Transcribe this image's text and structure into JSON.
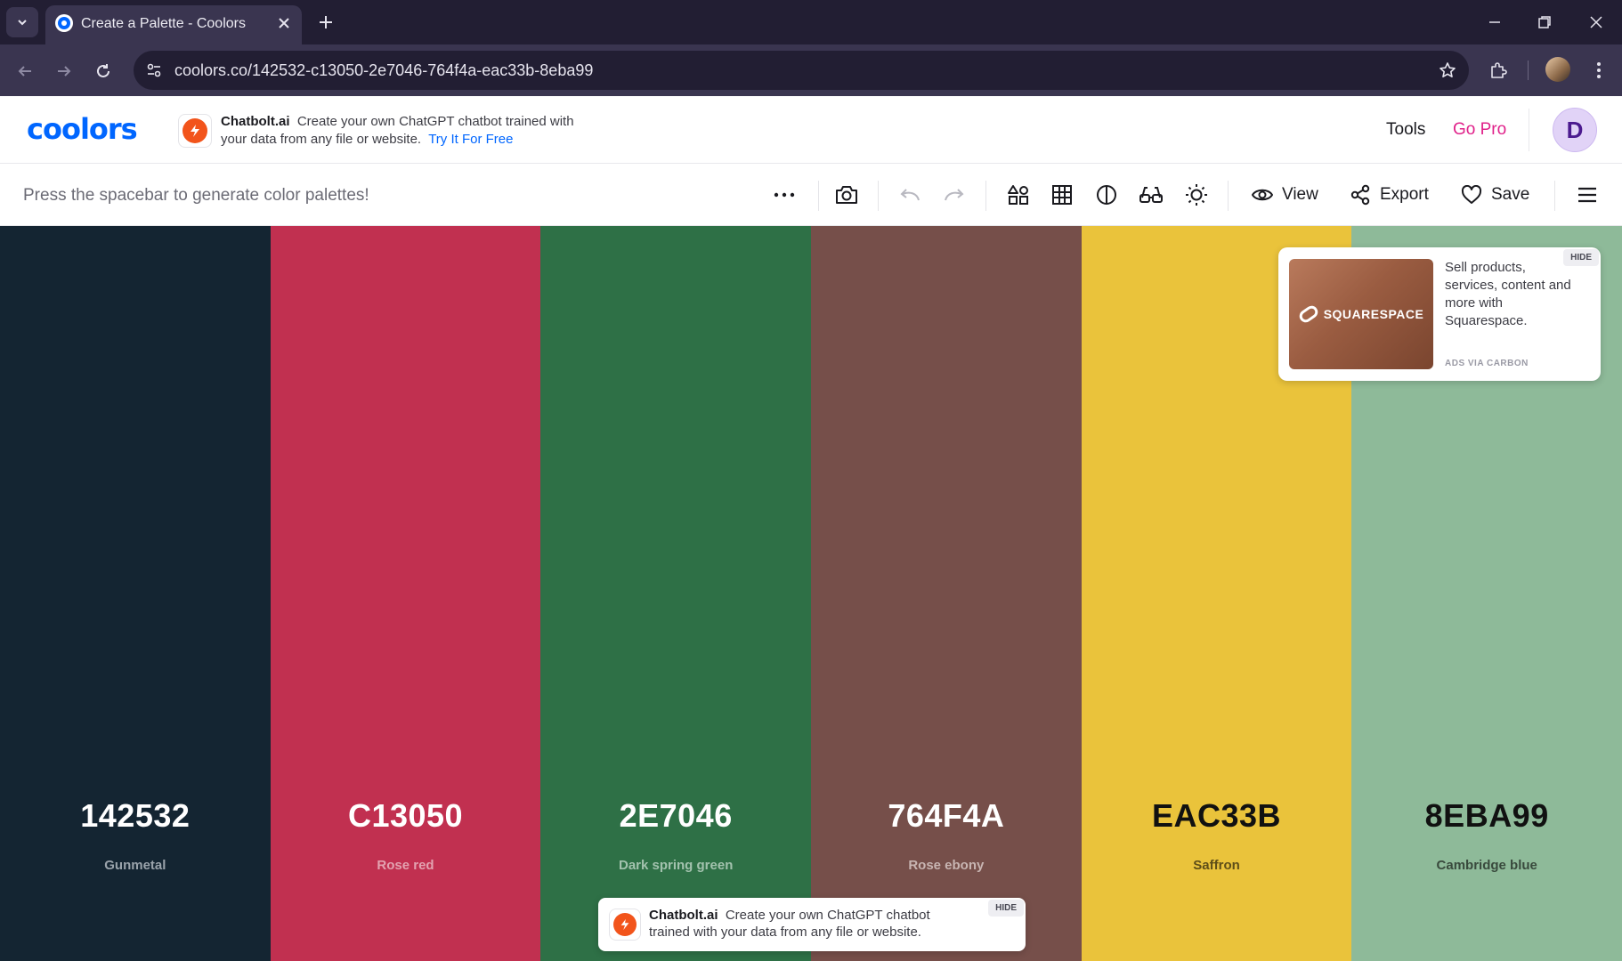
{
  "browser": {
    "tab_title": "Create a Palette - Coolors",
    "url": "coolors.co/142532-c13050-2e7046-764f4a-eac33b-8eba99"
  },
  "header": {
    "logo": "coolors",
    "ad": {
      "brand": "Chatbolt.ai",
      "text": "Create your own ChatGPT chatbot trained with your data from any file or website.",
      "cta": "Try It For Free"
    },
    "tools": "Tools",
    "go_pro": "Go Pro",
    "avatar_initial": "D"
  },
  "toolbar": {
    "hint": "Press the spacebar to generate color palettes!",
    "view": "View",
    "export": "Export",
    "save": "Save"
  },
  "palette": [
    {
      "hex": "142532",
      "name": "Gunmetal",
      "color": "#142532",
      "text_color": "#ffffff",
      "name_color": "#9aa3ab"
    },
    {
      "hex": "C13050",
      "name": "Rose red",
      "color": "#C13050",
      "text_color": "#ffffff",
      "name_color": "#e3a2b0"
    },
    {
      "hex": "2E7046",
      "name": "Dark spring green",
      "color": "#2E7046",
      "text_color": "#ffffff",
      "name_color": "#a3c2ae"
    },
    {
      "hex": "764F4A",
      "name": "Rose ebony",
      "color": "#764F4A",
      "text_color": "#ffffff",
      "name_color": "#c8b5b2"
    },
    {
      "hex": "EAC33B",
      "name": "Saffron",
      "color": "#EAC33B",
      "text_color": "#111111",
      "name_color": "#5e4e18"
    },
    {
      "hex": "8EBA99",
      "name": "Cambridge blue",
      "color": "#8EBA99",
      "text_color": "#111111",
      "name_color": "#394a3d"
    }
  ],
  "carbon_ad": {
    "logo_text": "SQUARESPACE",
    "text": "Sell products, services, content and more with Squarespace.",
    "via": "ADS VIA CARBON",
    "hide": "HIDE"
  },
  "bottom_ad": {
    "brand": "Chatbolt.ai",
    "text": "Create your own ChatGPT chatbot trained with your data from any file or website.",
    "hide": "HIDE"
  }
}
